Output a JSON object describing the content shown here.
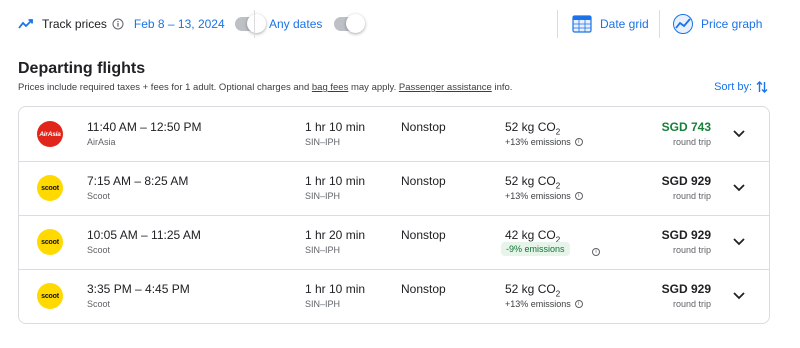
{
  "toolbar": {
    "track_prices_label": "Track prices",
    "date_range": "Feb 8 – 13, 2024",
    "any_dates_label": "Any dates",
    "date_grid_label": "Date grid",
    "price_graph_label": "Price graph"
  },
  "section": {
    "title": "Departing flights",
    "subtitle_before": "Prices include required taxes + fees for 1 adult. Optional charges and ",
    "bag_fees_link": "bag fees",
    "subtitle_middle": " may apply. ",
    "assistance_link": "Passenger assistance",
    "subtitle_after": " info.",
    "sort_label": "Sort by:"
  },
  "flights": [
    {
      "airline": "AirAsia",
      "logo_text": "AirAsia",
      "times": "11:40 AM – 12:50 PM",
      "duration": "1 hr 10 min",
      "route": "SIN–IPH",
      "stops": "Nonstop",
      "co2_value": "52 kg CO",
      "co2_sub": "2",
      "emissions": "+13% emissions",
      "price": "SGD 743",
      "trip_type": "round trip"
    },
    {
      "airline": "Scoot",
      "logo_text": "scoot",
      "times": "7:15 AM – 8:25 AM",
      "duration": "1 hr 10 min",
      "route": "SIN–IPH",
      "stops": "Nonstop",
      "co2_value": "52 kg CO",
      "co2_sub": "2",
      "emissions": "+13% emissions",
      "price": "SGD 929",
      "trip_type": "round trip"
    },
    {
      "airline": "Scoot",
      "logo_text": "scoot",
      "times": "10:05 AM – 11:25 AM",
      "duration": "1 hr 20 min",
      "route": "SIN–IPH",
      "stops": "Nonstop",
      "co2_value": "42 kg CO",
      "co2_sub": "2",
      "emissions": "-9% emissions",
      "price": "SGD 929",
      "trip_type": "round trip"
    },
    {
      "airline": "Scoot",
      "logo_text": "scoot",
      "times": "3:35 PM – 4:45 PM",
      "duration": "1 hr 10 min",
      "route": "SIN–IPH",
      "stops": "Nonstop",
      "co2_value": "52 kg CO",
      "co2_sub": "2",
      "emissions": "+13% emissions",
      "price": "SGD 929",
      "trip_type": "round trip"
    }
  ],
  "colors": {
    "accent": "#1a73e8",
    "cheapest_price": "#188038",
    "airasia_brand": "#e1251b",
    "scoot_brand": "#ffd900",
    "lower_emissions_bg": "#e6f4ea"
  },
  "icons": {
    "track": "trend-line-icon",
    "info": "info-icon",
    "date_grid": "calendar-grid-icon",
    "price_graph": "price-graph-icon",
    "sort": "sort-arrows-icon",
    "expand": "chevron-down-icon"
  }
}
